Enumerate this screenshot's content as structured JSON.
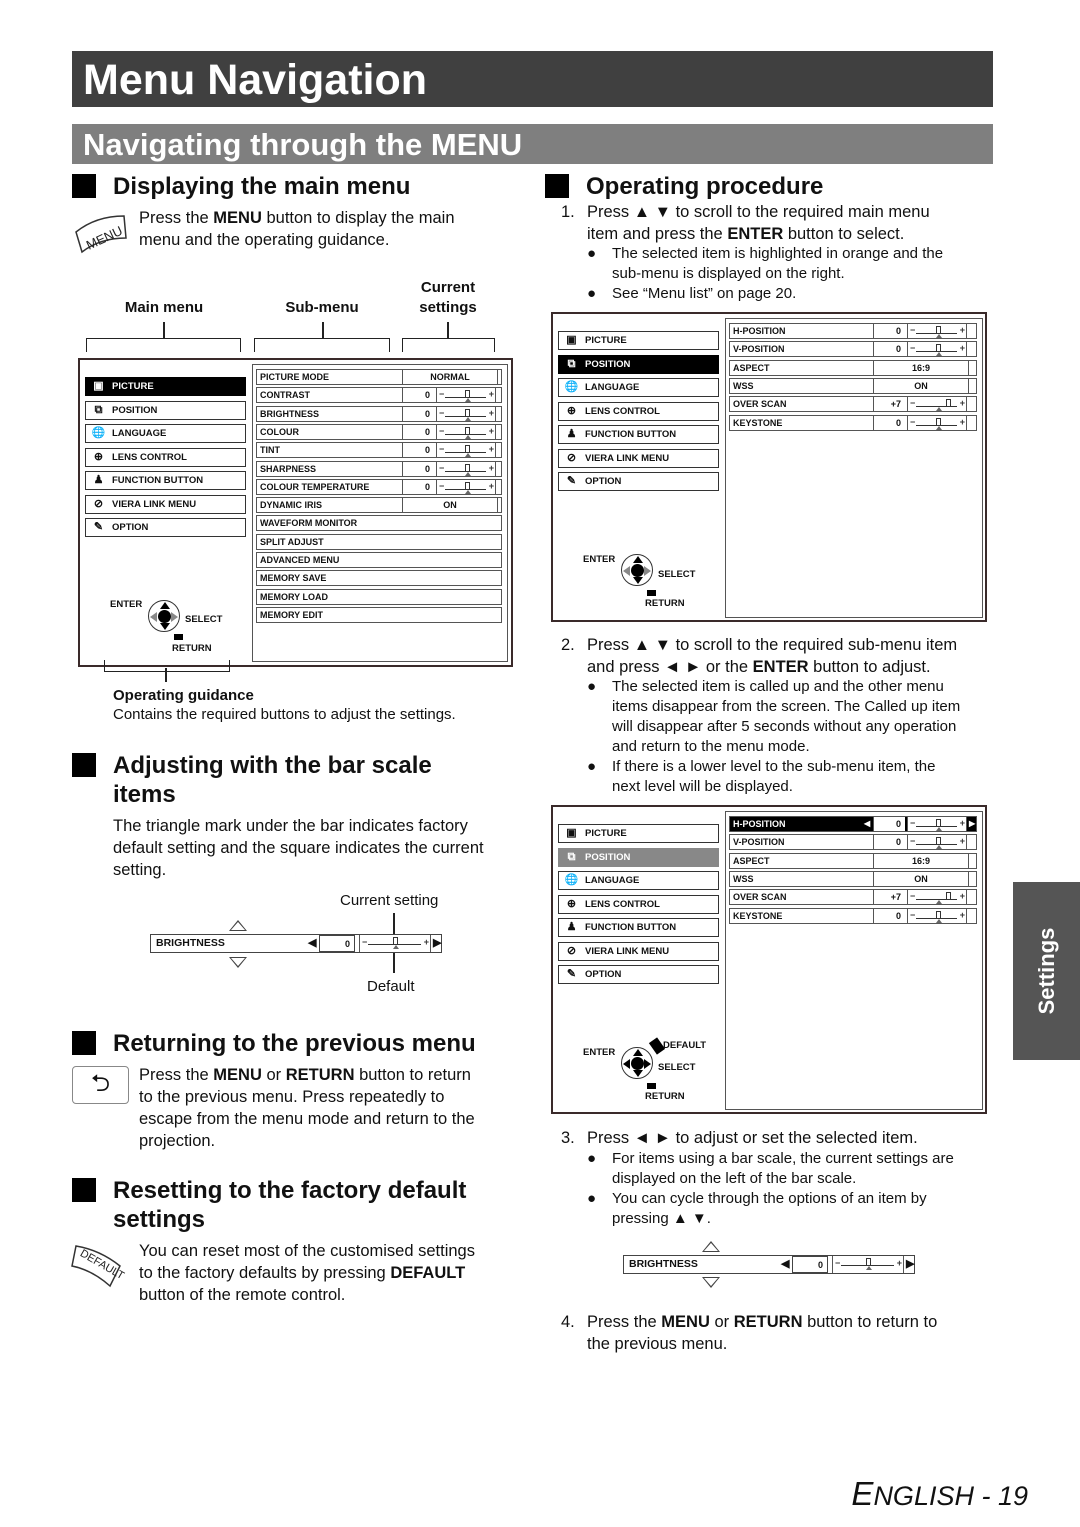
{
  "page_title": "Menu Navigation",
  "section_title": "Navigating through the MENU",
  "left": {
    "displaying": {
      "heading": "Displaying the main menu",
      "icon_label": "MENU",
      "text_pre": "Press the ",
      "text_bold": "MENU",
      "text_post1": " button to display the main",
      "text_line2": "menu and the operating guidance."
    },
    "diagram_labels": {
      "main_menu": "Main menu",
      "sub_menu": "Sub-menu",
      "current_line1": "Current",
      "current_line2": "settings",
      "operating_guidance": "Operating guidance",
      "guidance_desc": "Contains the required buttons to adjust the settings."
    },
    "bar_scale": {
      "heading_line1": "Adjusting with the bar scale",
      "heading_line2": "items",
      "text_line1": "The triangle mark under the bar indicates factory",
      "text_line2": "default setting and the square indicates the current",
      "text_line3": "setting.",
      "current_setting_label": "Current setting",
      "default_label": "Default",
      "example_item": "BRIGHTNESS",
      "example_value": "0"
    },
    "returning": {
      "heading": "Returning to the previous menu",
      "line1_pre": "Press the ",
      "line1_b1": "MENU",
      "line1_mid": " or ",
      "line1_b2": "RETURN",
      "line1_post": " button to return",
      "line2": "to the previous menu. Press repeatedly to",
      "line3": "escape from the menu mode and return to the",
      "line4": "projection."
    },
    "resetting": {
      "heading_line1": "Resetting to the factory default",
      "heading_line2": "settings",
      "icon_label": "DEFAULT",
      "line1": "You can reset most of the customised settings",
      "line2_pre": "to the factory defaults by pressing ",
      "line2_bold": "DEFAULT",
      "line3": "button of the remote control."
    }
  },
  "osd": {
    "main_menu": [
      {
        "label": "PICTURE",
        "icon": "picture-icon",
        "glyph": "▣"
      },
      {
        "label": "POSITION",
        "icon": "position-icon",
        "glyph": "⧉"
      },
      {
        "label": "LANGUAGE",
        "icon": "language-icon",
        "glyph": "🌐"
      },
      {
        "label": "LENS CONTROL",
        "icon": "lens-control-icon",
        "glyph": "⊕"
      },
      {
        "label": "FUNCTION BUTTON",
        "icon": "function-button-icon",
        "glyph": "♟"
      },
      {
        "label": "VIERA LINK MENU",
        "icon": "viera-link-icon",
        "glyph": "⊘"
      },
      {
        "label": "OPTION",
        "icon": "option-icon",
        "glyph": "✎"
      }
    ],
    "picture_submenu": [
      {
        "label": "PICTURE MODE",
        "value": "NORMAL"
      },
      {
        "label": "CONTRAST",
        "value": "0",
        "bar": 0.5
      },
      {
        "label": "BRIGHTNESS",
        "value": "0",
        "bar": 0.5
      },
      {
        "label": "COLOUR",
        "value": "0",
        "bar": 0.5
      },
      {
        "label": "TINT",
        "value": "0",
        "bar": 0.5
      },
      {
        "label": "SHARPNESS",
        "value": "0",
        "bar": 0.5
      },
      {
        "label": "COLOUR TEMPERATURE",
        "value": "0",
        "bar": 0.5
      },
      {
        "label": "DYNAMIC IRIS",
        "value": "ON"
      },
      {
        "label": "WAVEFORM MONITOR"
      },
      {
        "label": "SPLIT ADJUST"
      },
      {
        "label": "ADVANCED MENU"
      },
      {
        "label": "MEMORY SAVE"
      },
      {
        "label": "MEMORY LOAD"
      },
      {
        "label": "MEMORY EDIT"
      }
    ],
    "position_submenu": [
      {
        "label": "H-POSITION",
        "value": "0",
        "bar": 0.5
      },
      {
        "label": "V-POSITION",
        "value": "0",
        "bar": 0.5
      },
      {
        "label": "ASPECT",
        "value": "16:9"
      },
      {
        "label": "WSS",
        "value": "ON"
      },
      {
        "label": "OVER SCAN",
        "value": "+7",
        "bar": 0.75
      },
      {
        "label": "KEYSTONE",
        "value": "0",
        "bar": 0.5
      }
    ],
    "guide": {
      "enter": "ENTER",
      "select": "SELECT",
      "return": "RETURN",
      "default": "DEFAULT"
    }
  },
  "right": {
    "heading": "Operating procedure",
    "step1": {
      "num": "1.",
      "line1": "Press ▲ ▼ to scroll to the required main menu",
      "line2_pre": "item and press the ",
      "line2_bold": "ENTER",
      "line2_post": " button to select.",
      "bullets": [
        {
          "l1": "The selected item is highlighted in orange and the",
          "l2": "sub-menu is displayed on the right."
        },
        {
          "l1": "See “Menu list” on page 20.",
          "l2": ""
        }
      ]
    },
    "step2": {
      "num": "2.",
      "line1": "Press ▲ ▼ to scroll to the required sub-menu item",
      "line2_pre": "and press ◄ ► or the ",
      "line2_bold": "ENTER",
      "line2_post": " button to adjust.",
      "bullets": [
        {
          "l1": "The selected item is called up and the other menu",
          "l2": "items disappear from the screen. The Called up item",
          "l3": "will disappear after 5 seconds without any operation",
          "l4": "and return to the menu mode."
        },
        {
          "l1": "If there is a lower level to the sub-menu item, the",
          "l2": "next level will be displayed."
        }
      ]
    },
    "step3": {
      "num": "3.",
      "line1": "Press ◄ ► to adjust or set the selected item.",
      "bullets": [
        {
          "l1": "For items using a bar scale, the current settings are",
          "l2": "displayed on the left of the bar scale."
        },
        {
          "l1": "You can cycle through the options of an item by",
          "l2": "pressing ▲ ▼."
        }
      ],
      "example_item": "BRIGHTNESS",
      "example_value": "0"
    },
    "step4": {
      "num": "4.",
      "line1_pre": "Press the ",
      "line1_b1": "MENU",
      "line1_mid": " or ",
      "line1_b2": "RETURN",
      "line1_post": " button to return to",
      "line2": "the previous menu."
    }
  },
  "side_tab": "Settings",
  "footer": {
    "cap": "E",
    "rest": "NGLISH - 19"
  },
  "bullet_glyph": "●"
}
